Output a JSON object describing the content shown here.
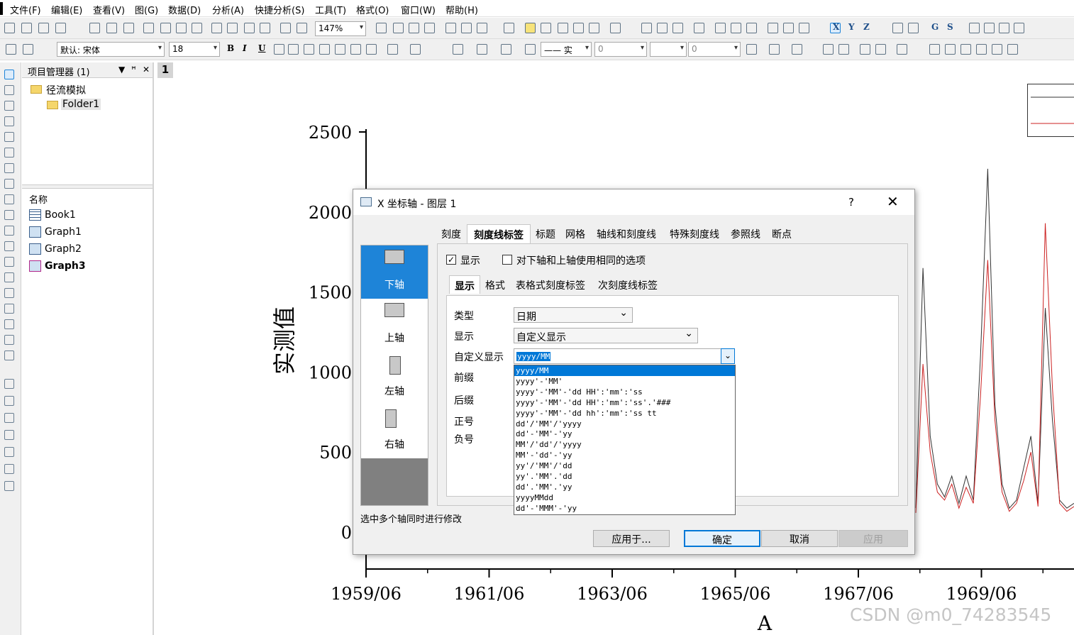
{
  "menu": [
    "文件(F)",
    "编辑(E)",
    "查看(V)",
    "图(G)",
    "数据(D)",
    "分析(A)",
    "快捷分析(S)",
    "工具(T)",
    "格式(O)",
    "窗口(W)",
    "帮助(H)"
  ],
  "toolbar": {
    "zoom": "147%",
    "font_name": "默认: 宋体",
    "font_size": "18",
    "line_style": "—— 实",
    "value1": "0",
    "value2": "0",
    "axis_letters": [
      "X",
      "Y",
      "Z",
      "G",
      "S"
    ],
    "text_letters": [
      "B",
      "I",
      "U"
    ]
  },
  "project_manager": {
    "title": "项目管理器 (1)",
    "root_folder": "径流模拟",
    "subfolder": "Folder1",
    "column_header": "名称",
    "items": [
      {
        "name": "Book1",
        "type": "book-icon"
      },
      {
        "name": "Graph1",
        "type": "graph-icon"
      },
      {
        "name": "Graph2",
        "type": "graph-icon"
      },
      {
        "name": "Graph3",
        "type": "graph-icon",
        "bold": true
      }
    ]
  },
  "graph": {
    "layer_number": "1",
    "y_axis_title": "实测值",
    "x_axis_title": "A"
  },
  "chart_data": {
    "type": "line",
    "ylabel": "实测值",
    "xlabel": "A",
    "ylim": [
      0,
      2500
    ],
    "y_ticks": [
      "0",
      "500",
      "1000",
      "1500",
      "2000",
      "2500"
    ],
    "x_tick_labels": [
      "1959/06",
      "1961/06",
      "1963/06",
      "1965/06",
      "1967/06",
      "1969/06"
    ],
    "series": [
      {
        "color": "#333333",
        "values": [
          150,
          1650,
          600,
          300,
          220,
          350,
          180,
          350,
          200,
          1100,
          2270,
          800,
          300,
          150,
          200,
          400,
          600,
          180,
          1400,
          700,
          200,
          150,
          180
        ]
      },
      {
        "color": "#cc2222",
        "values": [
          120,
          1050,
          500,
          250,
          200,
          300,
          150,
          280,
          180,
          850,
          1700,
          700,
          250,
          130,
          180,
          320,
          500,
          160,
          1930,
          900,
          180,
          130,
          160
        ]
      }
    ]
  },
  "dialog": {
    "title": "X 坐标轴 - 图层 1",
    "help": "?",
    "close": "✕",
    "axes": [
      "下轴",
      "上轴",
      "左轴",
      "右轴"
    ],
    "tabs": [
      "刻度",
      "刻度线标签",
      "标题",
      "网格",
      "轴线和刻度线",
      "特殊刻度线",
      "参照线",
      "断点"
    ],
    "show_label": "显示",
    "same_options_label": "对下轴和上轴使用相同的选项",
    "subtabs": [
      "显示",
      "格式",
      "表格式刻度标签",
      "次刻度线标签"
    ],
    "fields": {
      "type_label": "类型",
      "type_value": "日期",
      "display_label": "显示",
      "display_value": "自定义显示",
      "custom_label": "自定义显示",
      "custom_value": "yyyy/MM",
      "prefix_label": "前缀",
      "suffix_label": "后缀",
      "plus_label": "正号",
      "minus_label": "负号"
    },
    "dropdown_options": [
      "yyyy/MM",
      "yyyy'-'MM'",
      "yyyy'-'MM'-'dd HH':'mm':'ss",
      "yyyy'-'MM'-'dd HH':'mm':'ss'.'###",
      "yyyy'-'MM'-'dd hh':'mm':'ss tt",
      "dd'/'MM'/'yyyy",
      "dd'-'MM'-'yy",
      "MM'/'dd'/'yyyy",
      "MM'-'dd'-'yy",
      "yy'/'MM'/'dd",
      "yy'.'MM'.'dd",
      "dd'.'MM'.'yy",
      "yyyyMMdd",
      "dd'-'MMM'-'yy"
    ],
    "note": "选中多个轴同时进行修改",
    "buttons": {
      "apply_to": "应用于...",
      "ok": "确定",
      "cancel": "取消",
      "apply": "应用"
    }
  },
  "watermark": "CSDN @m0_74283545"
}
